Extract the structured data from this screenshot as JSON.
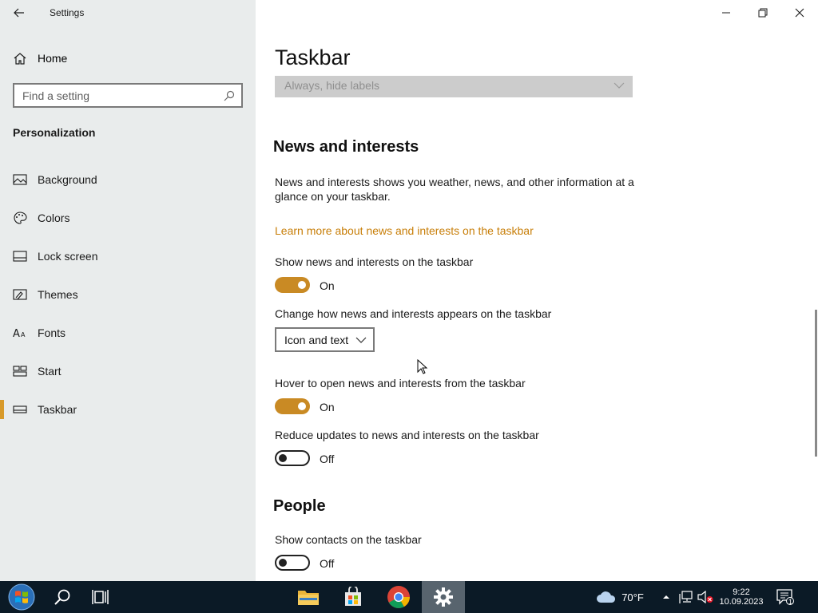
{
  "app": {
    "title": "Settings"
  },
  "sidebar": {
    "home_label": "Home",
    "search_placeholder": "Find a setting",
    "section": "Personalization",
    "items": [
      {
        "label": "Background",
        "icon": "image-icon"
      },
      {
        "label": "Colors",
        "icon": "palette-icon"
      },
      {
        "label": "Lock screen",
        "icon": "lock-screen-icon"
      },
      {
        "label": "Themes",
        "icon": "themes-icon"
      },
      {
        "label": "Fonts",
        "icon": "fonts-icon"
      },
      {
        "label": "Start",
        "icon": "start-icon"
      },
      {
        "label": "Taskbar",
        "icon": "taskbar-icon",
        "active": true
      }
    ]
  },
  "main": {
    "page_title": "Taskbar",
    "labels_dropdown": {
      "value": "Always, hide labels",
      "disabled": true
    },
    "news": {
      "heading": "News and interests",
      "description": "News and interests shows you weather, news, and other information at a glance on your taskbar.",
      "link": "Learn more about news and interests on the taskbar",
      "show_label": "Show news and interests on the taskbar",
      "show_state": "On",
      "appearance_label": "Change how news and interests appears on the taskbar",
      "appearance_value": "Icon and text",
      "hover_label": "Hover to open news and interests from the taskbar",
      "hover_state": "On",
      "reduce_label": "Reduce updates to news and interests on the taskbar",
      "reduce_state": "Off"
    },
    "people": {
      "heading": "People",
      "contacts_label": "Show contacts on the taskbar",
      "contacts_state": "Off"
    }
  },
  "taskbar": {
    "weather": "70°F",
    "time": "9:22",
    "date": "10.09.2023",
    "notifications": "1"
  },
  "colors": {
    "accent": "#c98a24",
    "link": "#c87f0a",
    "sidebar_bg": "#e9ecec",
    "taskbar_bg": "#0b1a26"
  }
}
